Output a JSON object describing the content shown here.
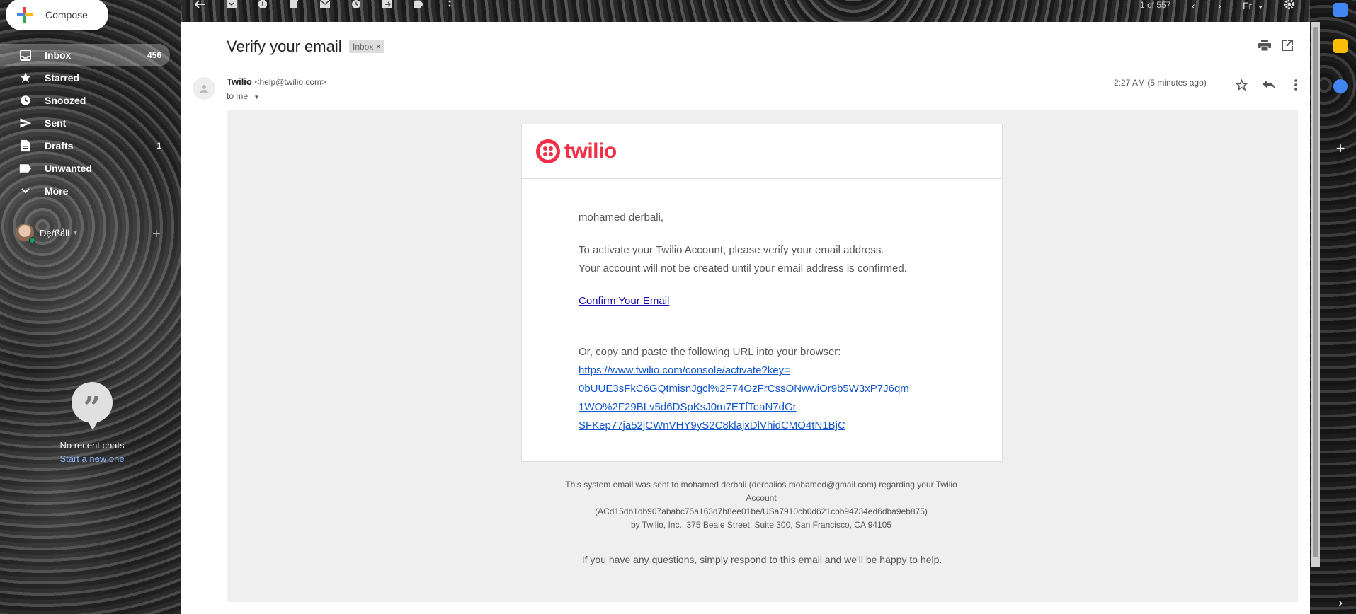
{
  "compose": {
    "label": "Compose"
  },
  "nav": {
    "items": [
      {
        "label": "Inbox",
        "count": "456",
        "icon": "inbox-icon"
      },
      {
        "label": "Starred",
        "count": "",
        "icon": "star-icon"
      },
      {
        "label": "Snoozed",
        "count": "",
        "icon": "clock-icon"
      },
      {
        "label": "Sent",
        "count": "",
        "icon": "send-icon"
      },
      {
        "label": "Drafts",
        "count": "1",
        "icon": "draft-icon"
      },
      {
        "label": "Unwanted",
        "count": "",
        "icon": "label-icon"
      },
      {
        "label": "More",
        "count": "",
        "icon": "chevron-down-icon"
      }
    ]
  },
  "hangouts": {
    "user_name": "Đęŕßåli",
    "no_chats": "No recent chats",
    "start_new": "Start a new one"
  },
  "toolbar": {
    "pager": "1 of 557",
    "language": "Fr"
  },
  "message": {
    "subject": "Verify your email",
    "tag": "Inbox",
    "tag_close": "×",
    "sender_name": "Twilio",
    "sender_email": "<help@twilio.com>",
    "to": "to me",
    "timestamp": "2:27 AM (5 minutes ago)"
  },
  "email": {
    "logo_text": "twilio",
    "greeting": "mohamed derbali,",
    "line1": "To activate your Twilio Account, please verify your email address.",
    "line2": "Your account will not be created until your email address is confirmed.",
    "confirm_link": "Confirm Your Email",
    "copy_text": "Or, copy and paste the following URL into your browser:",
    "url_line1": "https://www.twilio.com/console/activate?key=",
    "url_line2": "0bUUE3sFkC6GQtmisnJgcl%2F74OzFrCssONwwiOr9b5W3xP7J6qm",
    "url_line3": "1WO%2F29BLv5d6DSpKsJ0m7ETfTeaN7dGr",
    "url_line4": "SFKep77ja52jCWnVHY9yS2C8klajxDlVhidCMO4tN1BjC",
    "footer_line1": "This system email was sent to mohamed derbali (derbalios.mohamed@gmail.com) regarding your Twilio",
    "footer_line2": "Account",
    "footer_line3": "(ACd15db1db907ababc75a163d7b8ee01be/USa7910cb0d621cbb94734ed6dba9eb875)",
    "footer_line4": "by Twilio, Inc., 375 Beale Street, Suite 300, San Francisco, CA 94105",
    "help": "If you have any questions, simply respond to this email and we'll be happy to help."
  },
  "colors": {
    "twilio_red": "#f22f46",
    "link_blue": "#1155cc"
  }
}
